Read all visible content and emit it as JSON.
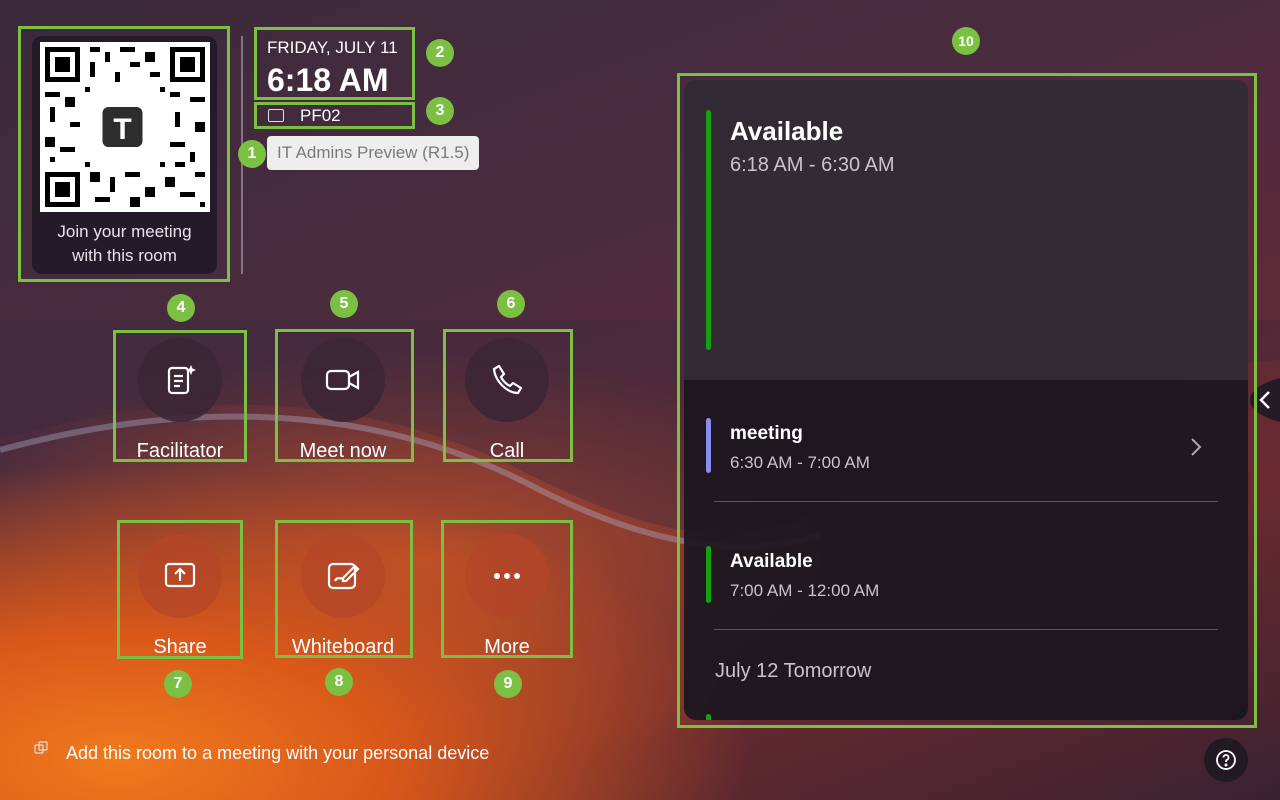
{
  "qr": {
    "caption_line1": "Join your meeting",
    "caption_line2": "with this room"
  },
  "header": {
    "date": "FRIDAY, JULY 11",
    "time": "6:18 AM",
    "room_name": "PF02",
    "build_label": "IT Admins Preview (R1.5)"
  },
  "actions": [
    {
      "label": "Facilitator",
      "icon": "facilitator-icon"
    },
    {
      "label": "Meet now",
      "icon": "video-icon"
    },
    {
      "label": "Call",
      "icon": "phone-icon"
    },
    {
      "label": "Share",
      "icon": "share-screen-icon"
    },
    {
      "label": "Whiteboard",
      "icon": "whiteboard-icon"
    },
    {
      "label": "More",
      "icon": "more-icon"
    }
  ],
  "footer": {
    "hint": "Add this room to a meeting with your personal device"
  },
  "schedule": {
    "current": {
      "title": "Available",
      "time": "6:18 AM - 6:30 AM",
      "bar_color": "#13a10e"
    },
    "events": [
      {
        "title": "meeting",
        "time": "6:30 AM - 7:00 AM",
        "bar_color": "#8b8cf0"
      },
      {
        "title": "Available",
        "time": "7:00 AM - 12:00 AM",
        "bar_color": "#13a10e"
      }
    ],
    "next_day_label": "July 12 Tomorrow"
  },
  "annotations": [
    "1",
    "2",
    "3",
    "4",
    "5",
    "6",
    "7",
    "8",
    "9",
    "10"
  ],
  "colors": {
    "annotation": "#7bc043",
    "available": "#13a10e",
    "meeting": "#8b8cf0"
  }
}
